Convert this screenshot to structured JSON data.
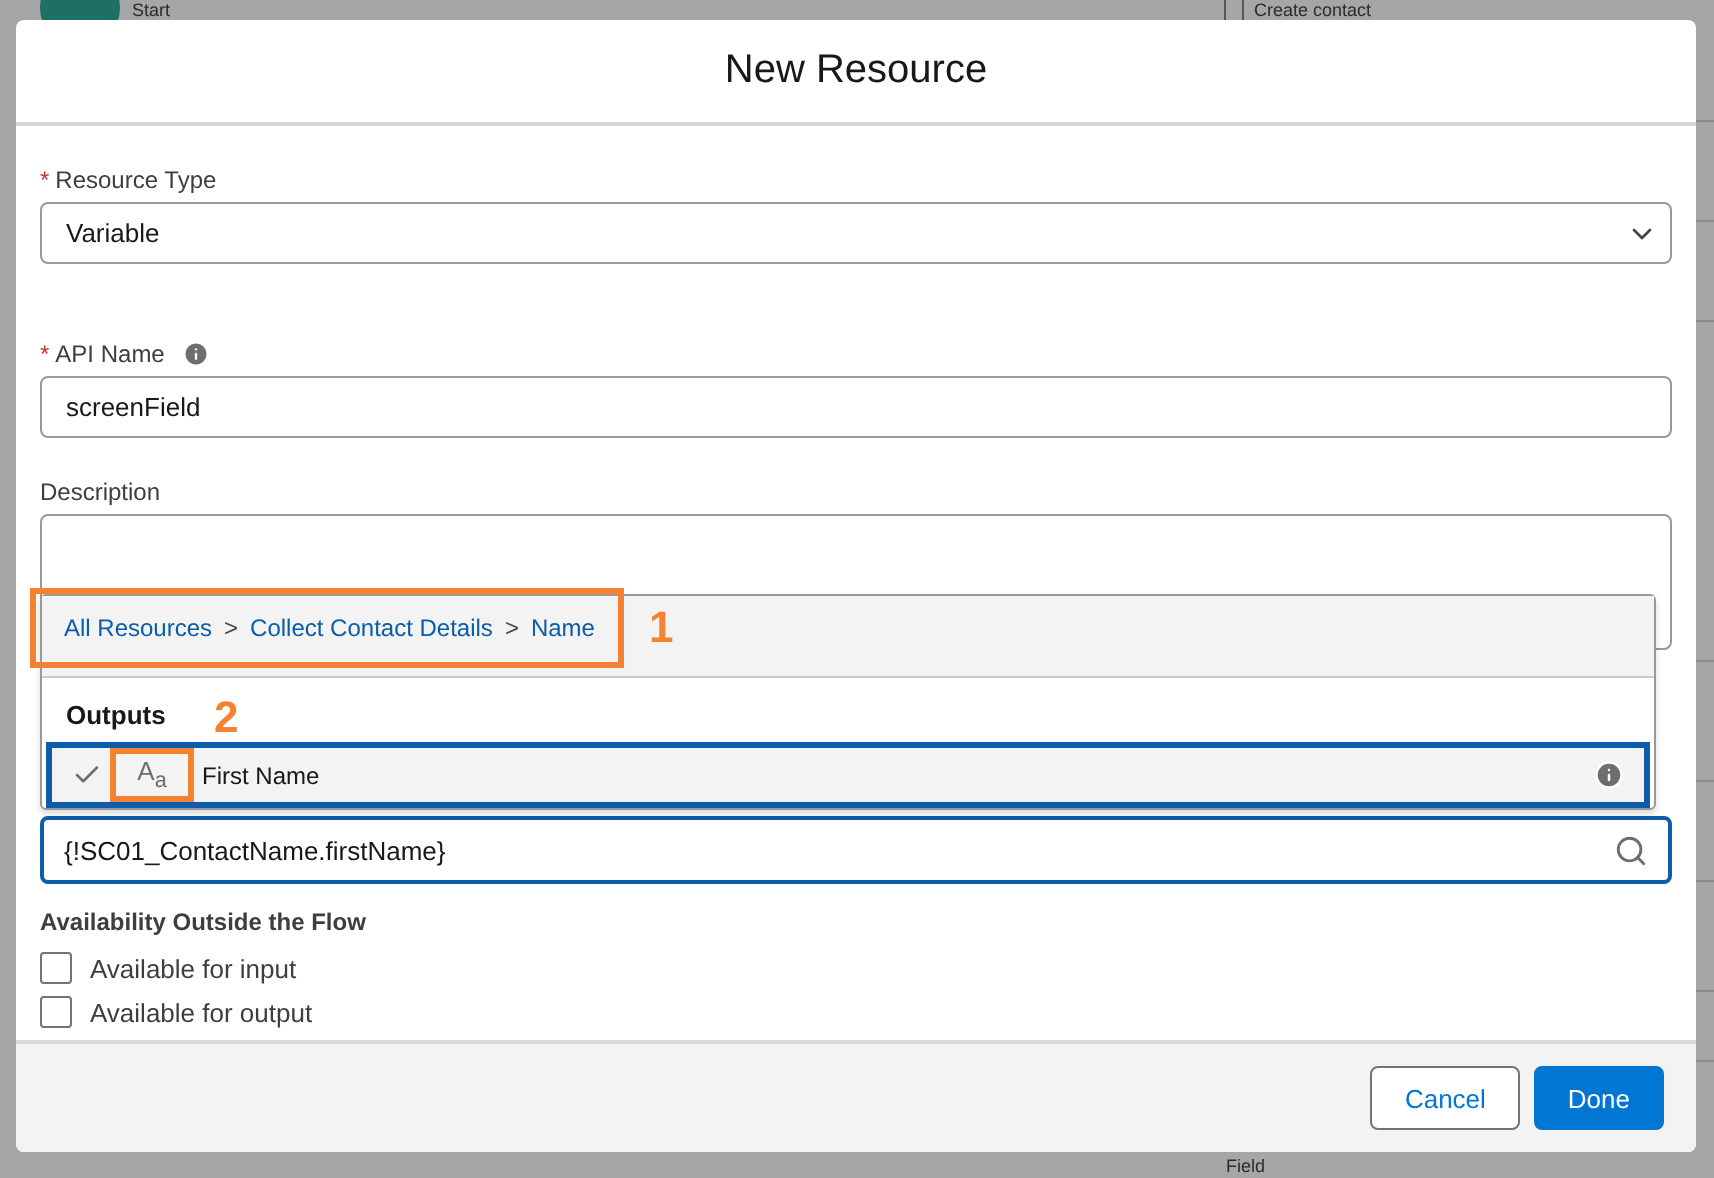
{
  "background": {
    "items": [
      {
        "label": "Start",
        "kind": "start"
      },
      {
        "label": "Create contact",
        "kind": "step"
      },
      {
        "label": "Field",
        "kind": "plain"
      }
    ]
  },
  "dialog": {
    "title": "New Resource",
    "resource_type": {
      "label": "Resource Type",
      "required_mark": "*",
      "value": "Variable"
    },
    "api_name": {
      "label": "API Name",
      "required_mark": "*",
      "value": "screenField"
    },
    "description": {
      "label": "Description"
    },
    "resource_picker": {
      "breadcrumbs": [
        "All Resources",
        "Collect Contact Details",
        "Name"
      ],
      "separator": ">",
      "section": "Outputs",
      "items": [
        {
          "type_mark": "A$_{a}$",
          "label": "First Name",
          "selected": true
        }
      ],
      "search_value": "{!SC01_ContactName.firstName}"
    },
    "availability": {
      "heading": "Availability Outside the Flow",
      "options": [
        {
          "label": "Available for input",
          "checked": false
        },
        {
          "label": "Available for output",
          "checked": false
        }
      ]
    },
    "buttons": [
      {
        "label": "Cancel",
        "kind": "neutral"
      },
      {
        "label": "Done",
        "kind": "brand"
      }
    ]
  },
  "annotations": [
    {
      "label": "1"
    },
    {
      "label": "2"
    }
  ]
}
